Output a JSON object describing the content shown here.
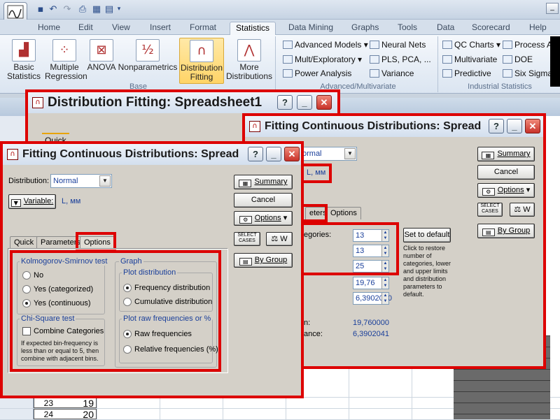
{
  "ribbon": {
    "tabs": [
      "Home",
      "Edit",
      "View",
      "Insert",
      "Format",
      "Statistics",
      "Data Mining",
      "Graphs",
      "Tools",
      "Data",
      "Scorecard",
      "Help"
    ],
    "active_tab": "Statistics",
    "base_group": {
      "label": "Base",
      "buttons": [
        "Basic Statistics",
        "Multiple Regression",
        "ANOVA",
        "Nonparametrics",
        "Distribution Fitting",
        "More Distributions"
      ]
    },
    "advanced_group": {
      "label": "Advanced/Multivariate",
      "items": [
        "Advanced Models",
        "Mult/Exploratory",
        "Power Analysis",
        "Neural Nets",
        "PLS, PCA, ...",
        "Variance"
      ]
    },
    "industrial_group": {
      "label": "Industrial Statistics",
      "items": [
        "QC Charts",
        "Process A",
        "Multivariate",
        "DOE",
        "Predictive",
        "Six Sigma"
      ]
    }
  },
  "spreadsheet": {
    "rows": [
      {
        "num": "23",
        "value": "19"
      },
      {
        "num": "24",
        "value": "20"
      }
    ]
  },
  "dialog_back": {
    "title": "Distribution Fitting: Spreadsheet1",
    "quick_tab": "Quick"
  },
  "dialog_right": {
    "title": "Fitting Continuous Distributions: Spread",
    "distribution": "ormal",
    "variable": "L, мм",
    "tabs": [
      "eters",
      "Options"
    ],
    "buttons": {
      "summary": "Summary",
      "cancel": "Cancel",
      "options": "Options",
      "select_cases": "SELECT CASES",
      "weight": "W",
      "by_group": "By Group",
      "set_default": "Set to default"
    },
    "fields": [
      {
        "label": "egories:",
        "value": "13"
      },
      {
        "label": "",
        "value": "13"
      },
      {
        "label": "",
        "value": "25"
      },
      {
        "label": "",
        "value": "19,76"
      },
      {
        "label": "",
        "value": "6,3902040"
      }
    ],
    "set_default_note": "Click to restore number of categories, lower and upper limits and distribution parameters to default.",
    "stats": [
      {
        "label": "n:",
        "value": "19,760000"
      },
      {
        "label": "ance:",
        "value": "6,3902041"
      }
    ]
  },
  "dialog_front": {
    "title": "Fitting Continuous Distributions: Spread",
    "distribution_label": "Distribution:",
    "distribution": "Normal",
    "variable_button": "Variable:",
    "variable": "L, мм",
    "tabs": [
      "Quick",
      "Parameters",
      "Options"
    ],
    "buttons": {
      "summary": "Summary",
      "cancel": "Cancel",
      "options": "Options",
      "select_cases": "SELECT CASES",
      "weight": "W",
      "by_group": "By Group"
    },
    "ks_test": {
      "title": "Kolmogorov-Smirnov test",
      "options": [
        "No",
        "Yes (categorized)",
        "Yes (continuous)"
      ],
      "selected": 2
    },
    "chi_test": {
      "title": "Chi-Square test",
      "checkbox": "Combine Categories",
      "note": "If expected bin-frequency is less than or equal to 5, then combine with adjacent bins."
    },
    "graph": {
      "title": "Graph",
      "plot_distribution": {
        "title": "Plot distribution",
        "options": [
          "Frequency distribution",
          "Cumulative distribution"
        ],
        "selected": 0
      },
      "plot_raw": {
        "title": "Plot raw frequencies or %",
        "options": [
          "Raw frequencies",
          "Relative frequencies (%)"
        ],
        "selected": 0
      }
    }
  },
  "colors": {
    "highlight": "#dd0000",
    "dialog_bg": "#d4d0c8",
    "value_blue": "#1a3f9a"
  }
}
